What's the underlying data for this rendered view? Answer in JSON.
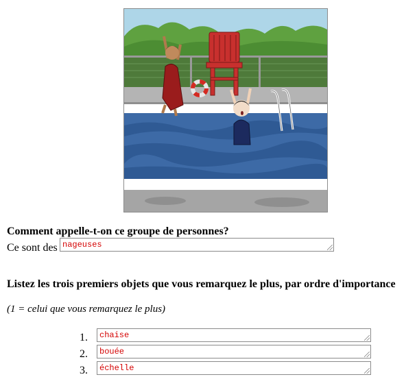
{
  "illustration": {
    "icon": "pool-scene-illustration"
  },
  "question1": {
    "title": "Comment appelle-t-on ce groupe de personnes?",
    "prefix": "Ce sont des",
    "answer": "nageuses"
  },
  "question2": {
    "title": "Listez les trois premiers objets que vous remarquez le plus, par ordre d'importance",
    "note": "(1 = celui que vous remarquez le plus)",
    "items": [
      {
        "number": "1.",
        "answer": "chaise"
      },
      {
        "number": "2.",
        "answer": "bouée"
      },
      {
        "number": "3.",
        "answer": "échelle"
      }
    ]
  },
  "colors": {
    "answer_text": "#d40000",
    "chair": "#c8302e",
    "water": "#3d6aa6"
  }
}
